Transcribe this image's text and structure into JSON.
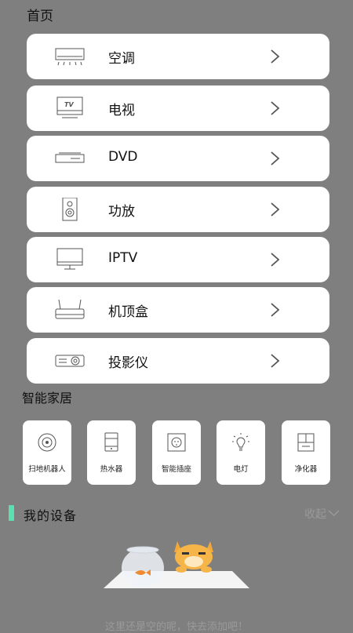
{
  "header": {
    "title": "首页"
  },
  "devices": [
    {
      "label": "空调",
      "icon": "air-conditioner-icon"
    },
    {
      "label": "电视",
      "icon": "tv-icon"
    },
    {
      "label": "DVD",
      "icon": "dvd-player-icon"
    },
    {
      "label": "功放",
      "icon": "speaker-icon"
    },
    {
      "label": "IPTV",
      "icon": "monitor-icon"
    },
    {
      "label": "机顶盒",
      "icon": "set-top-box-icon"
    },
    {
      "label": "投影仪",
      "icon": "projector-icon"
    }
  ],
  "smart_home": {
    "title": "智能家居",
    "items": [
      {
        "label": "扫地机器人",
        "icon": "robot-vacuum-icon"
      },
      {
        "label": "热水器",
        "icon": "water-heater-icon"
      },
      {
        "label": "智能插座",
        "icon": "smart-socket-icon"
      },
      {
        "label": "电灯",
        "icon": "light-bulb-icon"
      },
      {
        "label": "净化器",
        "icon": "air-purifier-icon"
      }
    ]
  },
  "my_devices": {
    "title": "我的设备",
    "collapse_label": "收起",
    "accent_color": "#5de0b0",
    "empty_text": "这里还是空的呢，快去添加吧！"
  },
  "tv_icon_text": "TV"
}
